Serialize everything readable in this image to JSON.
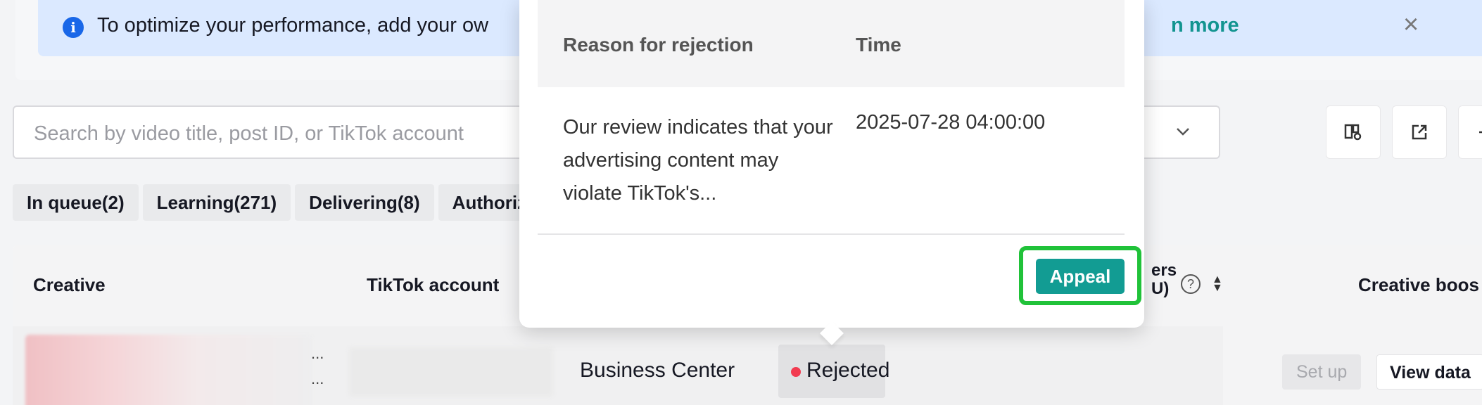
{
  "banner": {
    "message": "To optimize your performance, add your ow",
    "learn_more": "n more",
    "close": "×"
  },
  "search": {
    "placeholder": "Search by video title, post ID, or TikTok account"
  },
  "tabs": [
    {
      "label": "In queue(2)"
    },
    {
      "label": "Learning(271)"
    },
    {
      "label": "Delivering(8)"
    },
    {
      "label": "Authoriza"
    }
  ],
  "table": {
    "headers": {
      "creative": "Creative",
      "tiktok_account": "TikTok account",
      "users_line1": "ers",
      "users_line2": "U)",
      "creative_boost": "Creative boos"
    },
    "row": {
      "ellipsis_1": "...",
      "ellipsis_2": "...",
      "source": "Business Center",
      "status": "Rejected",
      "setup": "Set up",
      "view_data": "View data"
    }
  },
  "popover": {
    "col_reason": "Reason for rejection",
    "col_time": "Time",
    "reason_text": "Our review indicates that your advertising content may violate TikTok's...",
    "time_text": "2025-07-28 04:00:00",
    "appeal_label": "Appeal"
  },
  "icons": {
    "info": "i",
    "help": "?",
    "sort": "▲▼"
  },
  "colors": {
    "accent": "#129c93",
    "banner_bg": "#dbe9ff",
    "rejected_dot": "#f23b50",
    "focus_ring": "#20c239"
  }
}
